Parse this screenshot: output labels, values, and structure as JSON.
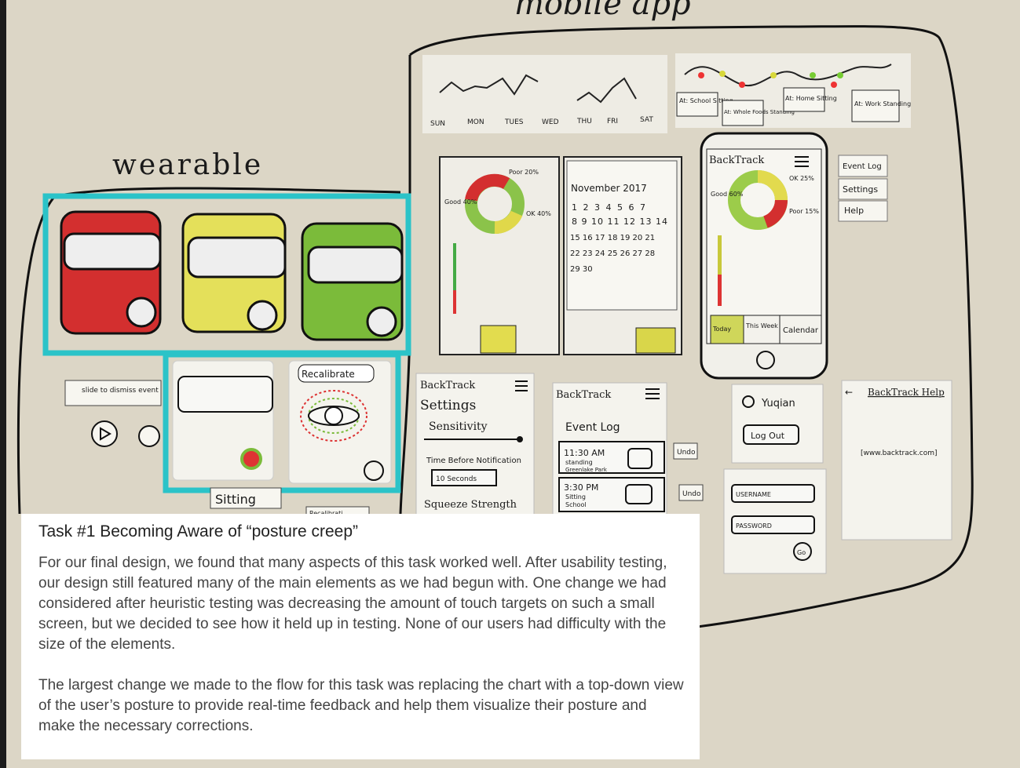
{
  "sketch": {
    "section_mobile": "mobile app",
    "section_wearable": "wearable",
    "week_days": [
      "SUN",
      "MON",
      "TUES",
      "WED",
      "THU",
      "FRI",
      "SAT"
    ],
    "location_tags": [
      "At: School Sitting",
      "At: Whole Foods Standing",
      "At: Home Sitting",
      "At: Work Standing"
    ],
    "donut_labels": {
      "good": "Good 40%",
      "poor": "Poor 20%",
      "ok": "OK 40%"
    },
    "calendar": {
      "title": "November 2017",
      "rows": [
        "1 2 3 4 5 6 7",
        "8 9 10 11 12 13 14",
        "15 16 17 18 19 20 21",
        "22 23 24 25 26 27 28",
        "29 30"
      ]
    },
    "phone": {
      "brand": "BackTrack",
      "labels": {
        "good": "Good 60%",
        "ok": "OK 25%",
        "poor": "Poor 15%"
      },
      "tabs": [
        "Today",
        "This Week",
        "Calendar"
      ]
    },
    "menu": [
      "Event Log",
      "Settings",
      "Help"
    ],
    "wearable_small": {
      "dismiss": "slide to dismiss event",
      "posture": "Sitting",
      "recalibrate": "Recalibrate",
      "recalib_partial": "Recalibrati"
    },
    "settings_screen": {
      "brand": "BackTrack",
      "title": "Settings",
      "sensitivity": "Sensitivity",
      "time_before": "Time Before Notification",
      "dropdown": "10 Seconds",
      "squeeze": "Squeeze Strength"
    },
    "event_log_screen": {
      "brand": "BackTrack",
      "title": "Event Log",
      "events": [
        {
          "time": "11:30 AM",
          "activity": "standing",
          "place": "Greenlake Park"
        },
        {
          "time": "3:30 PM",
          "activity": "Sitting",
          "place": "School"
        }
      ],
      "undo": "Undo"
    },
    "account": {
      "user": "Yuqian",
      "logout": "Log Out"
    },
    "login": {
      "username": "USERNAME",
      "password": "PASSWORD",
      "go": "Go"
    },
    "help": {
      "title": "BackTrack Help",
      "url": "[www.backtrack.com]"
    }
  },
  "caption": {
    "title": "Task #1 Becoming Aware of “posture creep”",
    "paragraph1": "For our final design, we found that many aspects of this task worked well. After usability testing, our design still featured many of the main elements as we had begun with.  One change we had considered after heuristic testing was decreasing the amount of touch targets on such a small screen, but we decided to see how it held up in testing.  None of our users had difficulty with the size of the elements.",
    "paragraph2": "The largest change we made to the flow for this task was replacing the chart with a top-down view of the user’s posture to provide real-time feedback and help them visualize their posture and make the necessary corrections."
  },
  "colors": {
    "wall": "#dcd6c6",
    "paper": "#f3f2ec",
    "highlight": "#2bc3c8",
    "red": "#d32f2f",
    "yellow": "#e4e05a",
    "green": "#7bbb3a"
  }
}
